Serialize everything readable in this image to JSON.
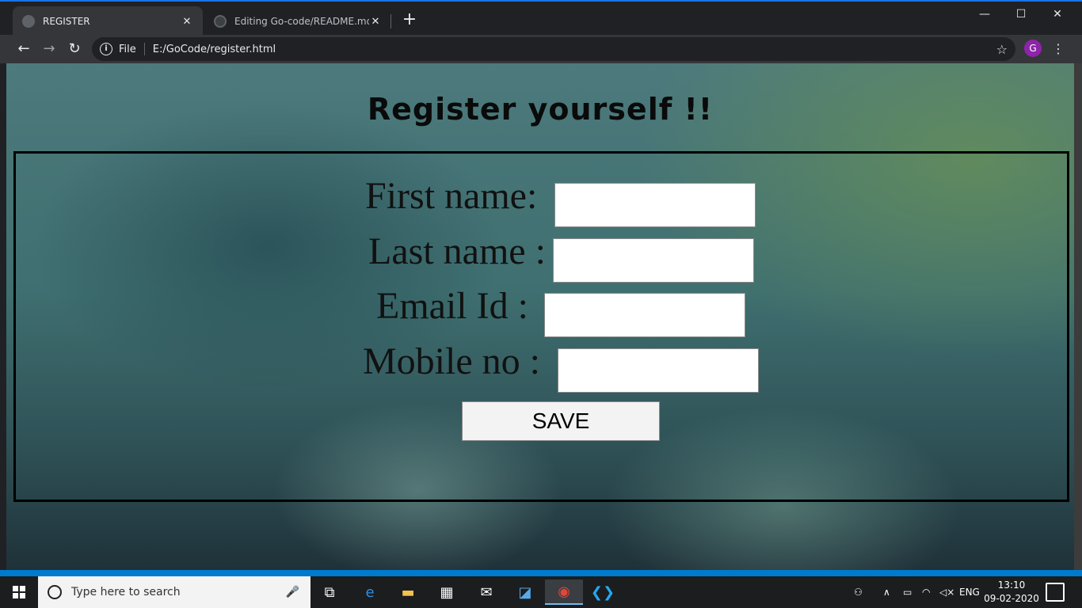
{
  "browser": {
    "tabs": [
      {
        "label": "REGISTER",
        "active": true
      },
      {
        "label": "Editing Go-code/README.md at",
        "active": false
      }
    ],
    "address": {
      "scheme_label": "File",
      "url": "E:/GoCode/register.html"
    },
    "profile_initial": "G",
    "accent_color": "#1a73e8"
  },
  "page": {
    "heading": "Register yourself !!",
    "fields": [
      {
        "label": "First name:",
        "value": ""
      },
      {
        "label": "Last name :",
        "value": ""
      },
      {
        "label": "Email Id :",
        "value": ""
      },
      {
        "label": "Mobile no :",
        "value": ""
      }
    ],
    "save_label": "SAVE"
  },
  "taskbar": {
    "search_placeholder": "Type here to search",
    "language": "ENG",
    "time": "13:10",
    "date": "09-02-2020",
    "pinned_icons": [
      "task-view-icon",
      "edge-icon",
      "file-explorer-icon",
      "store-icon",
      "mail-icon",
      "network-app-icon",
      "chrome-icon",
      "vscode-icon"
    ]
  }
}
